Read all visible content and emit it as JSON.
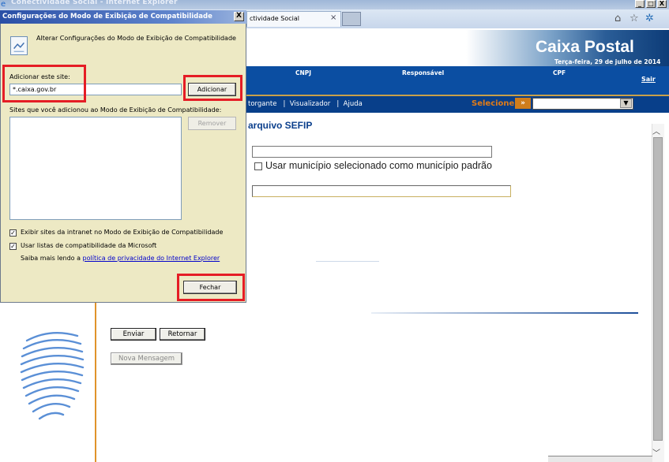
{
  "window": {
    "title": "Conectividade Social - Internet Explorer",
    "controls": [
      "_",
      "□",
      "X"
    ]
  },
  "tab": {
    "label": "ctividade Social",
    "close": "×"
  },
  "header": {
    "brand": "Caixa Postal",
    "date": "Terça-feira, 29 de julho de 2014",
    "columns": [
      "CNPJ",
      "Responsável",
      "CPF"
    ],
    "logout": "Sair"
  },
  "nav": {
    "links": "torgante   |  Visualizador   |  Ajuda",
    "select_label": "Selecione",
    "select_arrow": "»",
    "select_dropdown": "▼"
  },
  "content": {
    "heading": "arquivo SEFIP",
    "default_municipality_label": "Usar município selecionado como município padrão",
    "send_button": "Enviar",
    "back_button": "Retornar",
    "new_message_button": "Nova Mensagem"
  },
  "dialog": {
    "title": "Configurações do Modo de Exibição de Compatibilidade",
    "close": "X",
    "heading": "Alterar Configurações do Modo de Exibição de Compatibilidade",
    "add_site_label": "Adicionar este site:",
    "site_value": "*.caixa.gov.br",
    "add_button": "Adicionar",
    "list_label": "Sites que você adicionou ao Modo de Exibição de Compatibilidade:",
    "remove_button": "Remover",
    "intranet_label": "Exibir sites da intranet no Modo de Exibição de Compatibilidade",
    "ms_lists_label": "Usar listas de compatibilidade da Microsoft",
    "privacy_prefix": "Saiba mais lendo a ",
    "privacy_link": "política de privacidade do Internet Explorer",
    "close_button": "Fechar",
    "check_mark": "✓"
  },
  "colors": {
    "highlight": "#e51d25",
    "brand_blue": "#0b4ea2",
    "accent_orange": "#e07b17"
  }
}
